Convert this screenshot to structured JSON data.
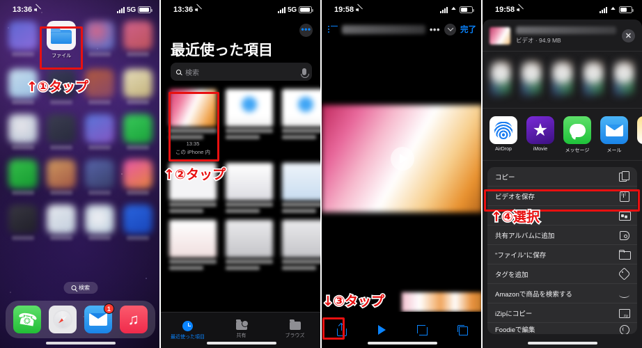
{
  "panels": {
    "p1": {
      "status": {
        "time": "13:36",
        "network": "5G",
        "mute_icon": "bell-slash-icon"
      },
      "files_app_label": "ファイル",
      "annotation": "①タップ",
      "annotation_arrow": "↑",
      "search_label": "検索",
      "dock": [
        {
          "name": "phone",
          "badge": ""
        },
        {
          "name": "safari",
          "badge": ""
        },
        {
          "name": "mail",
          "badge": "1"
        },
        {
          "name": "music",
          "badge": ""
        }
      ]
    },
    "p2": {
      "status": {
        "time": "13:36",
        "network": "5G"
      },
      "more_button": "•••",
      "title": "最近使った項目",
      "search_placeholder": "検索",
      "highlighted_file": {
        "time": "13:35",
        "location": "この iPhone 内"
      },
      "annotation": "②タップ",
      "annotation_arrow": "↑",
      "tabs": [
        {
          "label": "最近使った項目",
          "icon": "clock-icon",
          "active": true
        },
        {
          "label": "共有",
          "icon": "shared-folder-icon",
          "active": false
        },
        {
          "label": "ブラウズ",
          "icon": "folder-icon",
          "active": false
        }
      ]
    },
    "p3": {
      "status": {
        "time": "19:58",
        "network": "wifi"
      },
      "done_label": "完了",
      "more_dots": "•••",
      "annotation": "③タップ",
      "annotation_arrow": "↓",
      "toolbar": [
        {
          "name": "share-icon"
        },
        {
          "name": "play-icon"
        },
        {
          "name": "crop-icon"
        },
        {
          "name": "rotate-icon"
        }
      ]
    },
    "p4": {
      "status": {
        "time": "19:58",
        "network": "wifi"
      },
      "header": {
        "subtitle": "ビデオ · 94.9 MB",
        "close": "✕"
      },
      "apps": [
        {
          "label": "AirDrop",
          "icon": "airdrop-icon"
        },
        {
          "label": "iMovie",
          "icon": "imovie-icon"
        },
        {
          "label": "メッセージ",
          "icon": "messages-icon"
        },
        {
          "label": "メール",
          "icon": "mail-icon"
        },
        {
          "label": "",
          "icon": "notes-icon"
        }
      ],
      "annotation": "④選択",
      "annotation_arrow": "↑",
      "menu": [
        {
          "label": "コピー",
          "icon": "copy-icon",
          "highlighted": false
        },
        {
          "label": "ビデオを保存",
          "icon": "save-video-icon",
          "highlighted": true
        },
        {
          "label": "に追加",
          "icon": "photos-icon",
          "highlighted": false
        },
        {
          "label": "共有アルバムに追加",
          "icon": "shared-album-icon",
          "highlighted": false
        },
        {
          "label": "\"ファイル\"に保存",
          "icon": "folder-icon",
          "highlighted": false
        },
        {
          "label": "タグを追加",
          "icon": "tag-icon",
          "highlighted": false
        },
        {
          "label": "Amazonで商品を検索する",
          "icon": "amazon-icon",
          "highlighted": false
        },
        {
          "label": "iZipにコピー",
          "icon": "izip-icon",
          "highlighted": false
        },
        {
          "label": "Foodieで編集",
          "icon": "foodie-icon",
          "highlighted": false
        }
      ]
    }
  },
  "colors": {
    "accent": "#0a84ff",
    "highlight": "#e81010",
    "sheet_bg": "#1c1c1e",
    "row_bg": "#2c2c2e"
  }
}
